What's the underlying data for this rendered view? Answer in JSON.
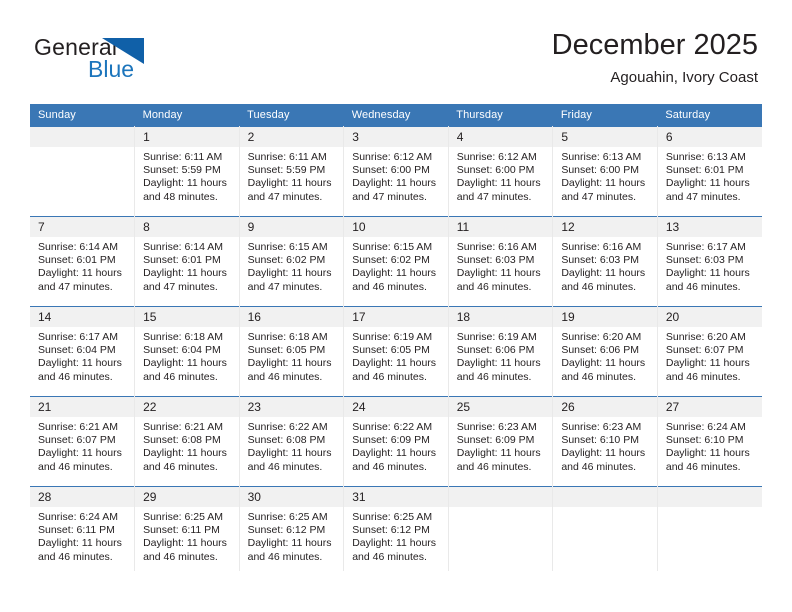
{
  "brand": {
    "name_part1": "General",
    "name_part2": "Blue",
    "accent_color": "#1c75bc",
    "triangle_color": "#1060a8",
    "logo_icon": "blue-triangle-icon"
  },
  "header": {
    "title": "December 2025",
    "subtitle": "Agouahin, Ivory Coast"
  },
  "theme": {
    "header_row_bg": "#3a77b5",
    "daynum_bg": "#f1f1f1",
    "text_color": "#231f20",
    "cell_border": "#e9e9e9"
  },
  "columns": [
    "Sunday",
    "Monday",
    "Tuesday",
    "Wednesday",
    "Thursday",
    "Friday",
    "Saturday"
  ],
  "weeks": [
    [
      {
        "day": "",
        "empty": true,
        "sunrise": "",
        "sunset": "",
        "daylight1": "",
        "daylight2": ""
      },
      {
        "day": "1",
        "sunrise": "Sunrise: 6:11 AM",
        "sunset": "Sunset: 5:59 PM",
        "daylight1": "Daylight: 11 hours",
        "daylight2": "and 48 minutes."
      },
      {
        "day": "2",
        "sunrise": "Sunrise: 6:11 AM",
        "sunset": "Sunset: 5:59 PM",
        "daylight1": "Daylight: 11 hours",
        "daylight2": "and 47 minutes."
      },
      {
        "day": "3",
        "sunrise": "Sunrise: 6:12 AM",
        "sunset": "Sunset: 6:00 PM",
        "daylight1": "Daylight: 11 hours",
        "daylight2": "and 47 minutes."
      },
      {
        "day": "4",
        "sunrise": "Sunrise: 6:12 AM",
        "sunset": "Sunset: 6:00 PM",
        "daylight1": "Daylight: 11 hours",
        "daylight2": "and 47 minutes."
      },
      {
        "day": "5",
        "sunrise": "Sunrise: 6:13 AM",
        "sunset": "Sunset: 6:00 PM",
        "daylight1": "Daylight: 11 hours",
        "daylight2": "and 47 minutes."
      },
      {
        "day": "6",
        "sunrise": "Sunrise: 6:13 AM",
        "sunset": "Sunset: 6:01 PM",
        "daylight1": "Daylight: 11 hours",
        "daylight2": "and 47 minutes."
      }
    ],
    [
      {
        "day": "7",
        "sunrise": "Sunrise: 6:14 AM",
        "sunset": "Sunset: 6:01 PM",
        "daylight1": "Daylight: 11 hours",
        "daylight2": "and 47 minutes."
      },
      {
        "day": "8",
        "sunrise": "Sunrise: 6:14 AM",
        "sunset": "Sunset: 6:01 PM",
        "daylight1": "Daylight: 11 hours",
        "daylight2": "and 47 minutes."
      },
      {
        "day": "9",
        "sunrise": "Sunrise: 6:15 AM",
        "sunset": "Sunset: 6:02 PM",
        "daylight1": "Daylight: 11 hours",
        "daylight2": "and 47 minutes."
      },
      {
        "day": "10",
        "sunrise": "Sunrise: 6:15 AM",
        "sunset": "Sunset: 6:02 PM",
        "daylight1": "Daylight: 11 hours",
        "daylight2": "and 46 minutes."
      },
      {
        "day": "11",
        "sunrise": "Sunrise: 6:16 AM",
        "sunset": "Sunset: 6:03 PM",
        "daylight1": "Daylight: 11 hours",
        "daylight2": "and 46 minutes."
      },
      {
        "day": "12",
        "sunrise": "Sunrise: 6:16 AM",
        "sunset": "Sunset: 6:03 PM",
        "daylight1": "Daylight: 11 hours",
        "daylight2": "and 46 minutes."
      },
      {
        "day": "13",
        "sunrise": "Sunrise: 6:17 AM",
        "sunset": "Sunset: 6:03 PM",
        "daylight1": "Daylight: 11 hours",
        "daylight2": "and 46 minutes."
      }
    ],
    [
      {
        "day": "14",
        "sunrise": "Sunrise: 6:17 AM",
        "sunset": "Sunset: 6:04 PM",
        "daylight1": "Daylight: 11 hours",
        "daylight2": "and 46 minutes."
      },
      {
        "day": "15",
        "sunrise": "Sunrise: 6:18 AM",
        "sunset": "Sunset: 6:04 PM",
        "daylight1": "Daylight: 11 hours",
        "daylight2": "and 46 minutes."
      },
      {
        "day": "16",
        "sunrise": "Sunrise: 6:18 AM",
        "sunset": "Sunset: 6:05 PM",
        "daylight1": "Daylight: 11 hours",
        "daylight2": "and 46 minutes."
      },
      {
        "day": "17",
        "sunrise": "Sunrise: 6:19 AM",
        "sunset": "Sunset: 6:05 PM",
        "daylight1": "Daylight: 11 hours",
        "daylight2": "and 46 minutes."
      },
      {
        "day": "18",
        "sunrise": "Sunrise: 6:19 AM",
        "sunset": "Sunset: 6:06 PM",
        "daylight1": "Daylight: 11 hours",
        "daylight2": "and 46 minutes."
      },
      {
        "day": "19",
        "sunrise": "Sunrise: 6:20 AM",
        "sunset": "Sunset: 6:06 PM",
        "daylight1": "Daylight: 11 hours",
        "daylight2": "and 46 minutes."
      },
      {
        "day": "20",
        "sunrise": "Sunrise: 6:20 AM",
        "sunset": "Sunset: 6:07 PM",
        "daylight1": "Daylight: 11 hours",
        "daylight2": "and 46 minutes."
      }
    ],
    [
      {
        "day": "21",
        "sunrise": "Sunrise: 6:21 AM",
        "sunset": "Sunset: 6:07 PM",
        "daylight1": "Daylight: 11 hours",
        "daylight2": "and 46 minutes."
      },
      {
        "day": "22",
        "sunrise": "Sunrise: 6:21 AM",
        "sunset": "Sunset: 6:08 PM",
        "daylight1": "Daylight: 11 hours",
        "daylight2": "and 46 minutes."
      },
      {
        "day": "23",
        "sunrise": "Sunrise: 6:22 AM",
        "sunset": "Sunset: 6:08 PM",
        "daylight1": "Daylight: 11 hours",
        "daylight2": "and 46 minutes."
      },
      {
        "day": "24",
        "sunrise": "Sunrise: 6:22 AM",
        "sunset": "Sunset: 6:09 PM",
        "daylight1": "Daylight: 11 hours",
        "daylight2": "and 46 minutes."
      },
      {
        "day": "25",
        "sunrise": "Sunrise: 6:23 AM",
        "sunset": "Sunset: 6:09 PM",
        "daylight1": "Daylight: 11 hours",
        "daylight2": "and 46 minutes."
      },
      {
        "day": "26",
        "sunrise": "Sunrise: 6:23 AM",
        "sunset": "Sunset: 6:10 PM",
        "daylight1": "Daylight: 11 hours",
        "daylight2": "and 46 minutes."
      },
      {
        "day": "27",
        "sunrise": "Sunrise: 6:24 AM",
        "sunset": "Sunset: 6:10 PM",
        "daylight1": "Daylight: 11 hours",
        "daylight2": "and 46 minutes."
      }
    ],
    [
      {
        "day": "28",
        "sunrise": "Sunrise: 6:24 AM",
        "sunset": "Sunset: 6:11 PM",
        "daylight1": "Daylight: 11 hours",
        "daylight2": "and 46 minutes."
      },
      {
        "day": "29",
        "sunrise": "Sunrise: 6:25 AM",
        "sunset": "Sunset: 6:11 PM",
        "daylight1": "Daylight: 11 hours",
        "daylight2": "and 46 minutes."
      },
      {
        "day": "30",
        "sunrise": "Sunrise: 6:25 AM",
        "sunset": "Sunset: 6:12 PM",
        "daylight1": "Daylight: 11 hours",
        "daylight2": "and 46 minutes."
      },
      {
        "day": "31",
        "sunrise": "Sunrise: 6:25 AM",
        "sunset": "Sunset: 6:12 PM",
        "daylight1": "Daylight: 11 hours",
        "daylight2": "and 46 minutes."
      },
      {
        "day": "",
        "empty": true,
        "sunrise": "",
        "sunset": "",
        "daylight1": "",
        "daylight2": ""
      },
      {
        "day": "",
        "empty": true,
        "sunrise": "",
        "sunset": "",
        "daylight1": "",
        "daylight2": ""
      },
      {
        "day": "",
        "empty": true,
        "sunrise": "",
        "sunset": "",
        "daylight1": "",
        "daylight2": ""
      }
    ]
  ]
}
